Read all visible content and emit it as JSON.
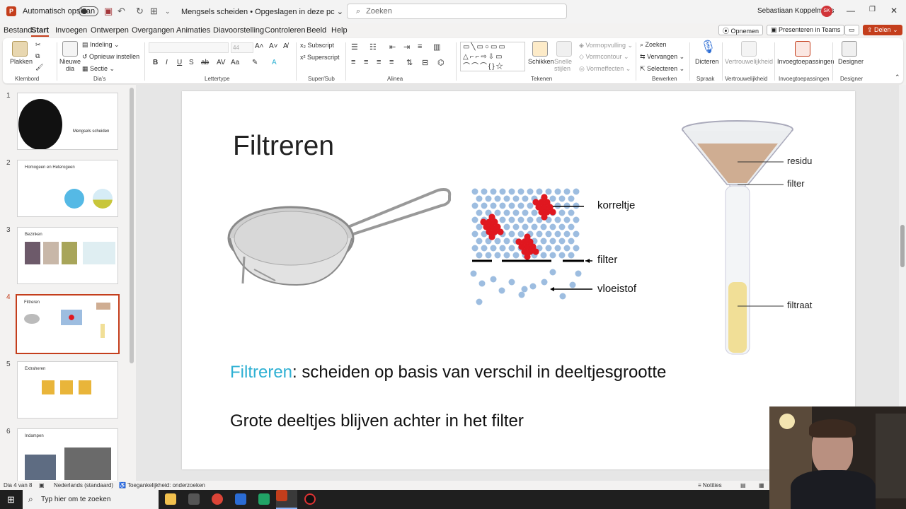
{
  "titlebar": {
    "autosave_label": "Automatisch opslaan",
    "doc_title": "Mengsels scheiden • Opgeslagen in deze pc ⌄",
    "search_placeholder": "Zoeken",
    "user_name": "Sebastiaan Koppelmans",
    "user_initials": "SK"
  },
  "tabs": [
    "Bestand",
    "Start",
    "Invoegen",
    "Ontwerpen",
    "Overgangen",
    "Animaties",
    "Diavoorstelling",
    "Controleren",
    "Beeld",
    "Help"
  ],
  "active_tab": "Start",
  "ribbon_right": {
    "record": "Opnemen",
    "present_teams": "Presenteren in Teams",
    "share": "Delen"
  },
  "ribbon": {
    "paste": "Plakken",
    "clipboard": "Klembord",
    "new_slide": "Nieuwe dia",
    "layout": "Indeling",
    "reset": "Opnieuw instellen",
    "section": "Sectie",
    "slides": "Dia's",
    "font_size": "44",
    "font_group": "Lettertype",
    "subscript": "Subscript",
    "superscript": "Superscript",
    "subsup_group": "Super/Sub",
    "paragraph": "Alinea",
    "arrange": "Schikken",
    "quick_styles": "Snelle stijlen",
    "shape_fill": "Vormopvulling",
    "shape_outline": "Vormcontour",
    "shape_effects": "Vormeffecten",
    "drawing": "Tekenen",
    "find": "Zoeken",
    "replace": "Vervangen",
    "select": "Selecteren",
    "editing": "Bewerken",
    "dictate": "Dicteren",
    "speech": "Spraak",
    "sensitivity": "Vertrouwelijkheid",
    "sensitivity_group": "Vertrouwelijkheid",
    "addins": "Invoegtoepassingen",
    "addins_group": "Invoegtoepassingen",
    "designer": "Designer",
    "designer_group": "Designer"
  },
  "thumbnails": [
    {
      "num": "1",
      "title": "Mengsels scheiden"
    },
    {
      "num": "2",
      "title": "Homogeen en Heterogeen"
    },
    {
      "num": "3",
      "title": "Bezinken"
    },
    {
      "num": "4",
      "title": "Filtreren"
    },
    {
      "num": "5",
      "title": "Extraheren"
    },
    {
      "num": "6",
      "title": "Indampen"
    }
  ],
  "slide": {
    "title": "Filtreren",
    "labels": {
      "korreltje": "korreltje",
      "filter": "filter",
      "vloeistof": "vloeistof",
      "residu": "residu",
      "filter2": "filter",
      "filtraat": "filtraat"
    },
    "definition_term": "Filtreren",
    "definition_rest": ": scheiden op basis van verschil in deeltjesgrootte",
    "line2": "Grote deeltjes blijven achter in het filter"
  },
  "status": {
    "slide_of": "Dia 4 van 8",
    "language": "Nederlands (standaard)",
    "accessibility": "Toegankelijkheid: onderzoeken",
    "notes": "Notities"
  },
  "taskbar": {
    "search_placeholder": "Typ hier om te zoeken"
  },
  "colors": {
    "accent": "#c43e1c",
    "cyan_text": "#2eb0d3",
    "particle_blue": "#9dbde0",
    "particle_red": "#e0171f",
    "filtrate_yellow": "#f1df97",
    "residue_tan": "#cfad92"
  }
}
